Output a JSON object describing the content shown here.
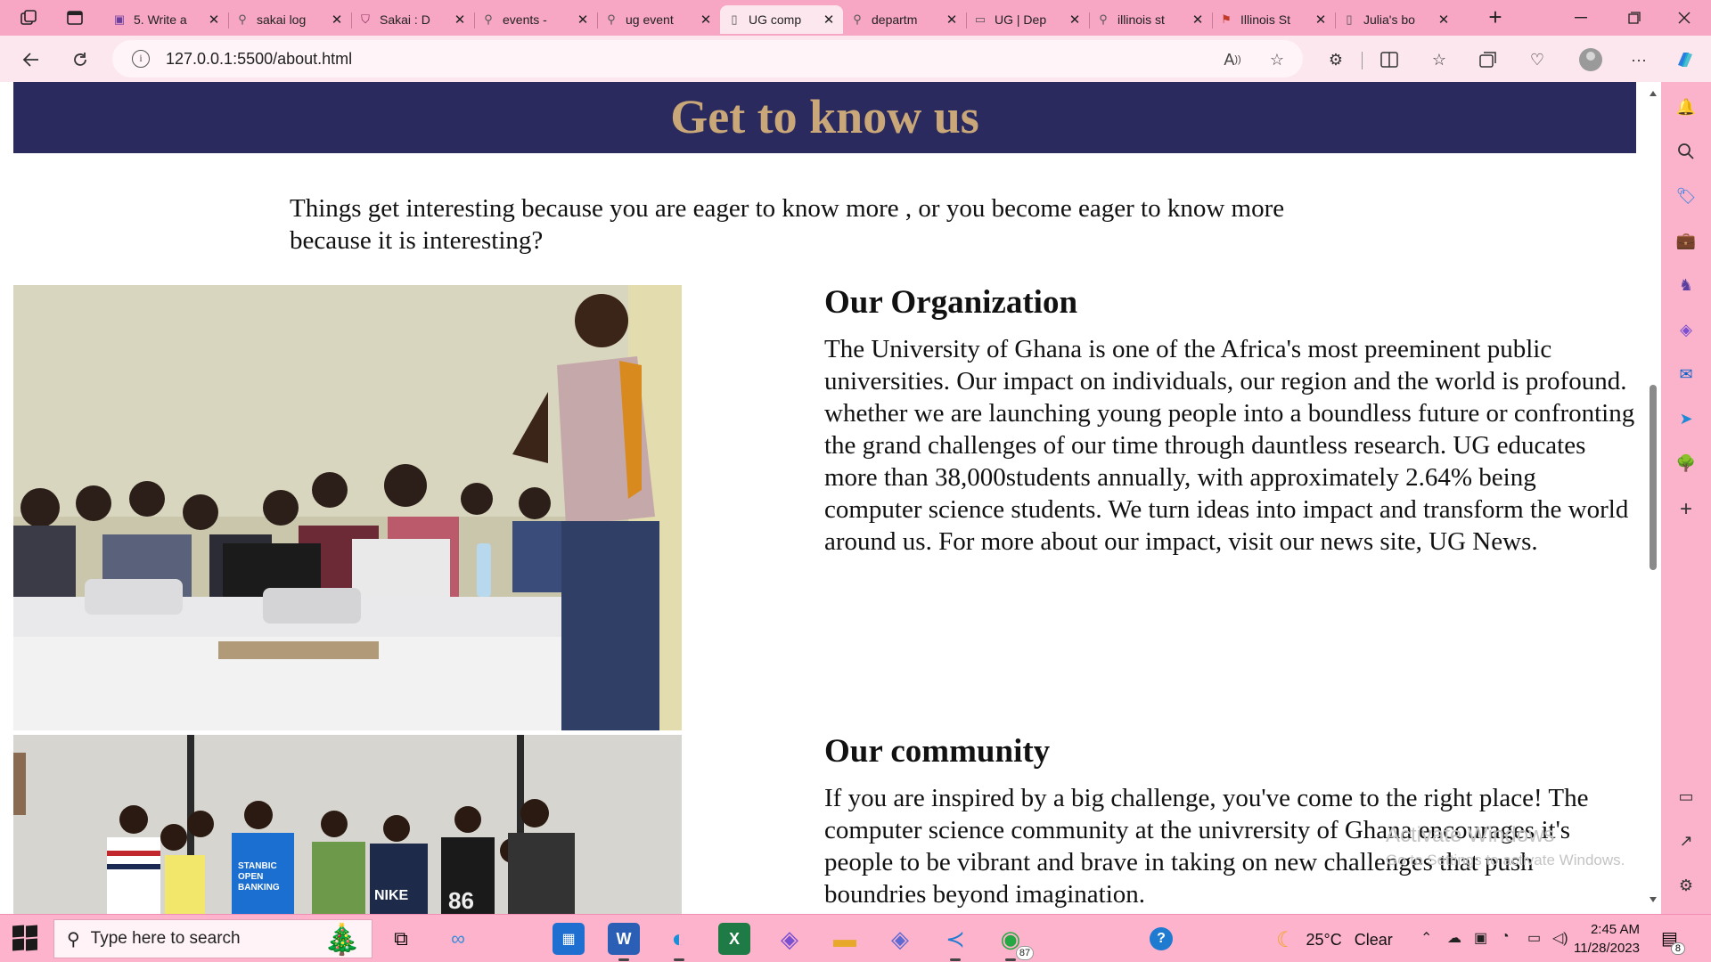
{
  "browser": {
    "tabs": [
      {
        "title": "5. Write a",
        "favicon": "app-icon",
        "color": "#6b3fa0"
      },
      {
        "title": "sakai log",
        "favicon": "search-icon"
      },
      {
        "title": "Sakai : D",
        "favicon": "shield-icon",
        "color": "#8a2e5c"
      },
      {
        "title": "events -",
        "favicon": "search-icon"
      },
      {
        "title": "ug event",
        "favicon": "search-icon"
      },
      {
        "title": "UG comp",
        "favicon": "page-icon",
        "active": true
      },
      {
        "title": "departm",
        "favicon": "search-icon"
      },
      {
        "title": "UG | Dep",
        "favicon": "link-icon"
      },
      {
        "title": "illinois st",
        "favicon": "search-icon"
      },
      {
        "title": "Illinois St",
        "favicon": "flag-icon",
        "color": "#c23b2a"
      },
      {
        "title": "Julia's bo",
        "favicon": "page-icon"
      }
    ],
    "url": "127.0.0.1:5500/about.html"
  },
  "page": {
    "banner_title": "Get to know us",
    "intro": "Things get interesting because you are eager to know more , or you become eager to know more because it is interesting?",
    "sections": [
      {
        "heading": "Our Organization",
        "body": "The University of Ghana is one of the Africa's most preeminent public universities. Our impact on individuals, our region and the world is profound. whether we are launching young people into a boundless future or confronting the grand challenges of our time through dauntless research. UG educates more than 38,000students annually, with approximately 2.64% being computer science students. We turn ideas into impact and transform the world around us. For more about our impact, visit our news site, UG News."
      },
      {
        "heading": "Our community",
        "body": "If you are inspired by a big challenge, you've come to the right place! The computer science community at the univrersity of Ghana encourages it's people to be vibrant and brave in taking on new challenges that push boundries beyond imagination."
      }
    ],
    "photos": [
      {
        "subject": "classroom-lecture-photo"
      },
      {
        "subject": "group-photo",
        "shirt_text": "STANBIC OPEN BANKING",
        "shirt_number": "86",
        "shirt_brand": "NIKE"
      }
    ],
    "watermark": {
      "title": "Activate Windows",
      "subtitle": "Go to Settings to activate Windows."
    }
  },
  "taskbar": {
    "search_placeholder": "Type here to search",
    "whatsapp_badge": "87",
    "weather": {
      "temp": "25°C",
      "condition": "Clear"
    },
    "time": "2:45 AM",
    "date": "11/28/2023",
    "notifications": "8"
  },
  "colors": {
    "banner_bg": "#2a2a5e",
    "banner_text": "#c9a778",
    "chrome_pink": "#f7a6c3"
  }
}
